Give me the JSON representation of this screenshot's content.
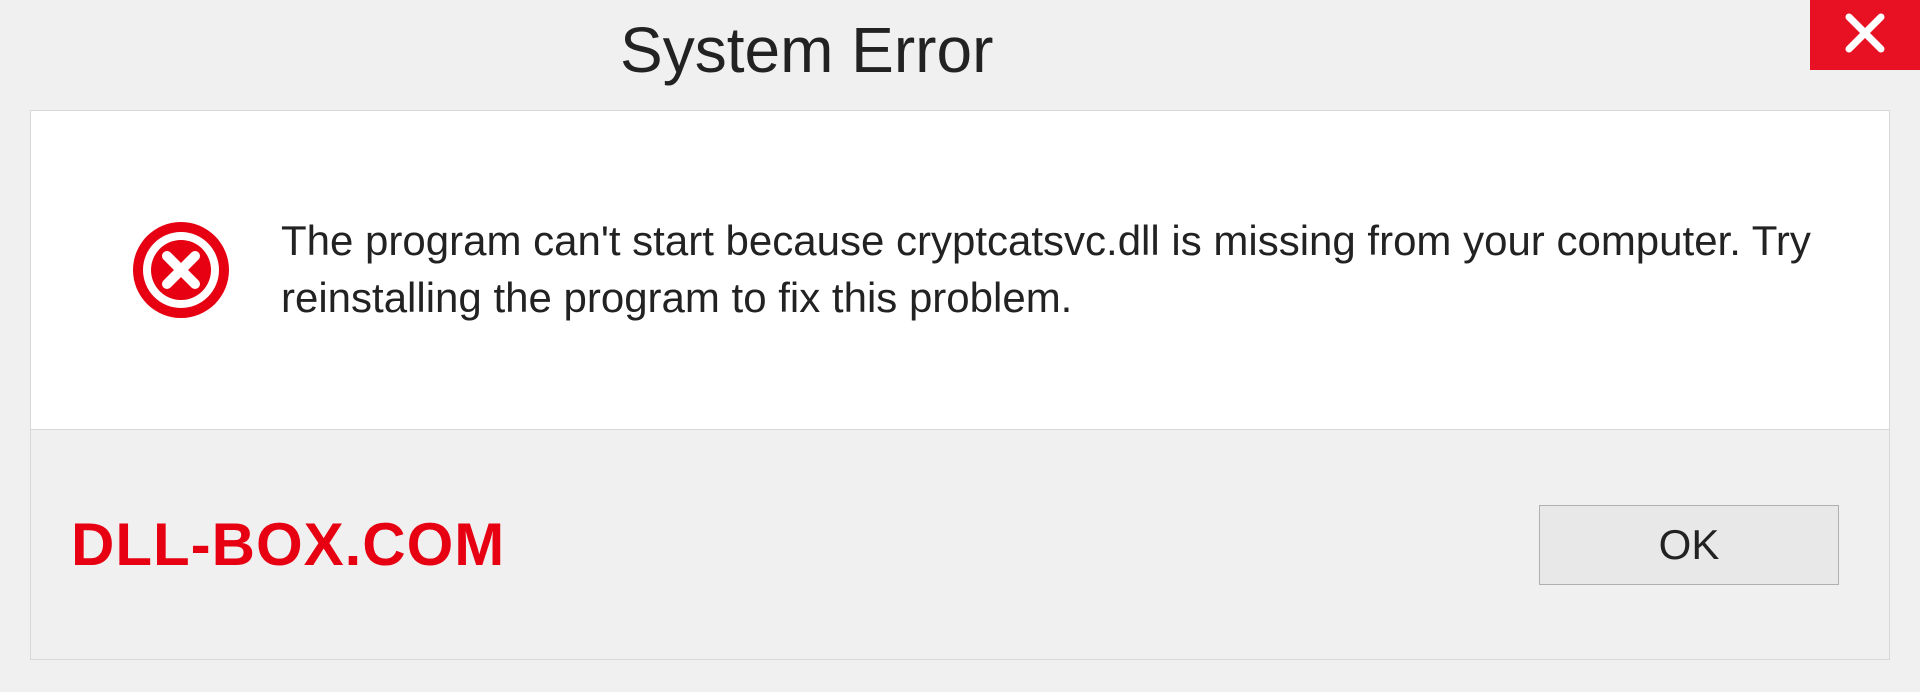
{
  "dialog": {
    "title": "System Error",
    "message": "The program can't start because cryptcatsvc.dll is missing from your computer. Try reinstalling the program to fix this problem.",
    "ok_label": "OK"
  },
  "watermark": "DLL-BOX.COM"
}
